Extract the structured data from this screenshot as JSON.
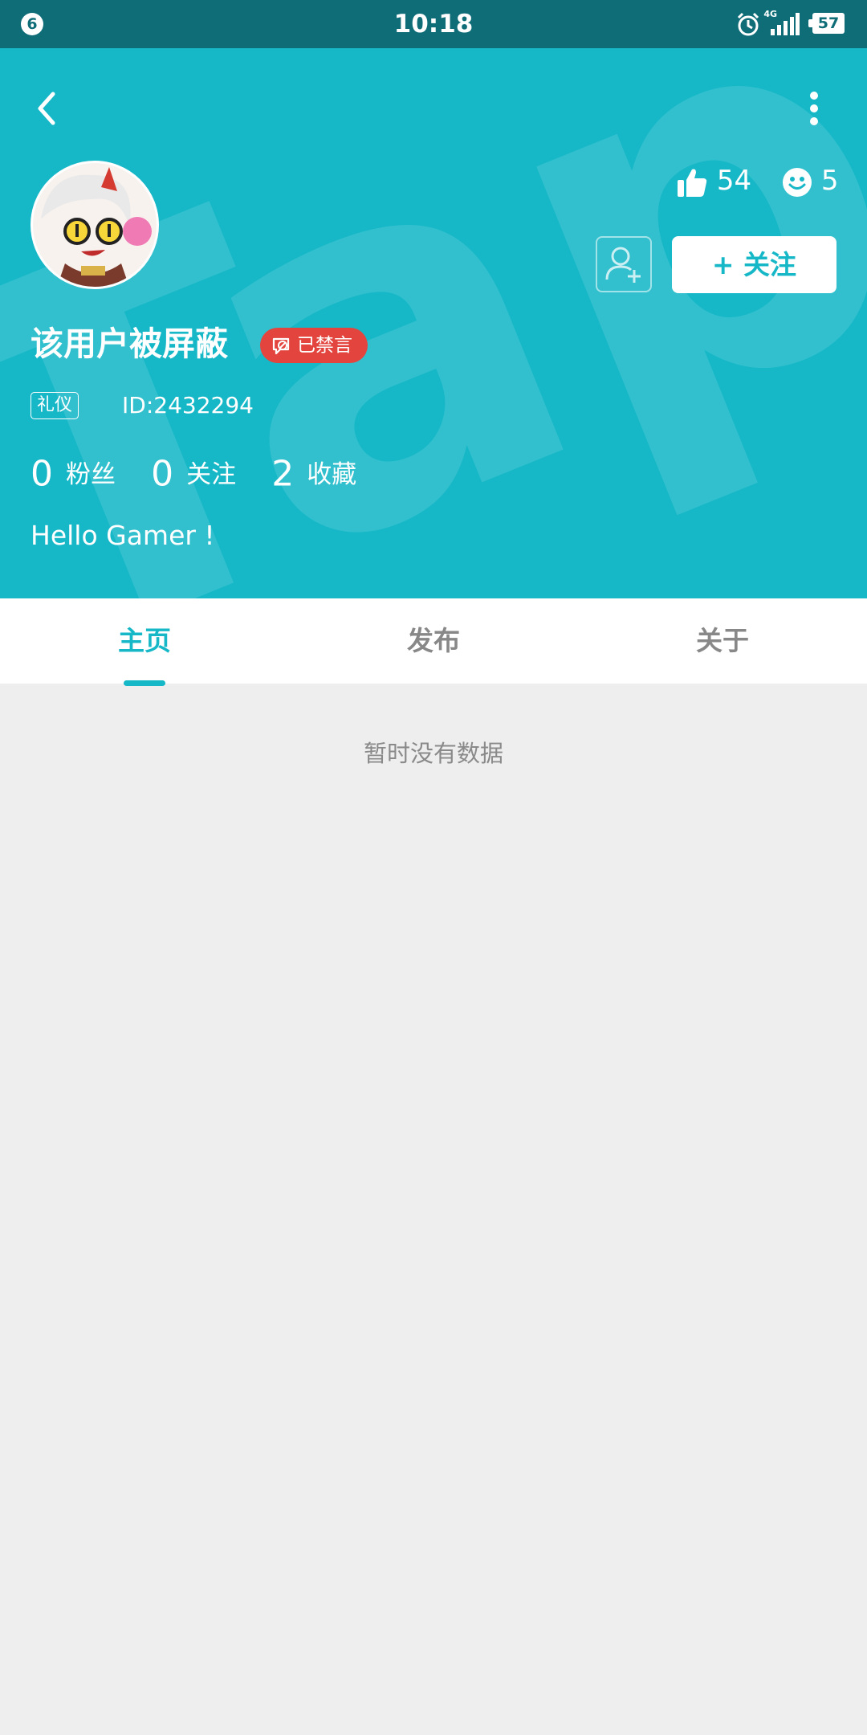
{
  "status_bar": {
    "notification_count": "6",
    "time": "10:18",
    "network": "4G",
    "battery": "57",
    "icons": [
      "alarm-icon",
      "signal-icon",
      "battery-icon"
    ]
  },
  "header": {
    "watermark_text": "TapTap",
    "back_icon": "chevron-left-icon",
    "more_icon": "more-vertical-icon",
    "likes": "54",
    "like_icon": "thumbs-up-icon",
    "smiles": "5",
    "smile_icon": "smile-icon",
    "add_friend_icon": "user-plus-icon",
    "follow_label": "+ 关注",
    "username": "该用户被屏蔽",
    "banned_label": "已禁言",
    "tag": "礼仪",
    "user_id": "ID:2432294",
    "stats": [
      {
        "value": "0",
        "label": "粉丝"
      },
      {
        "value": "0",
        "label": "关注"
      },
      {
        "value": "2",
        "label": "收藏"
      }
    ],
    "bio": "Hello Gamer !"
  },
  "tabs": [
    {
      "label": "主页",
      "active": true
    },
    {
      "label": "发布",
      "active": false
    },
    {
      "label": "关于",
      "active": false
    }
  ],
  "empty_text": "暂时没有数据",
  "colors": {
    "status_bar": "#0f6d78",
    "header": "#16b8c8",
    "accent": "#16b8c8",
    "banned": "#e3453e",
    "background": "#eeeeee"
  }
}
